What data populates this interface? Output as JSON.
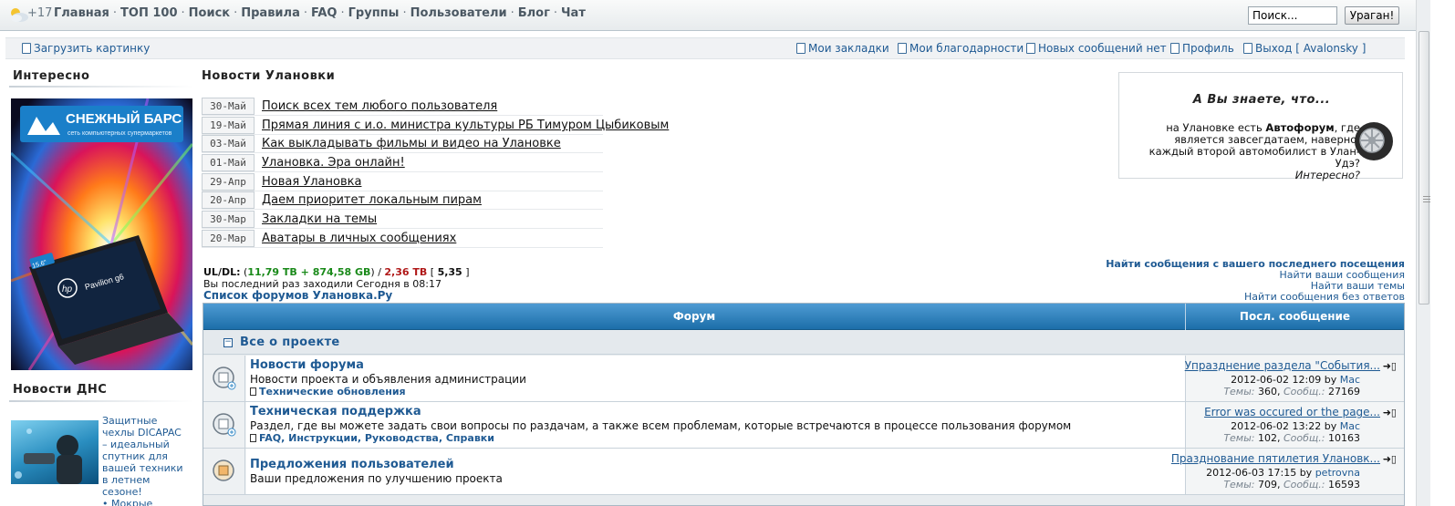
{
  "topbar": {
    "temperature": "+17",
    "nav": [
      "Главная",
      "ТОП 100",
      "Поиск",
      "Правила",
      "FAQ",
      "Группы",
      "Пользователи",
      "Блог",
      "Чат"
    ],
    "separator": "·",
    "search_placeholder": "Поиск...",
    "search_button": "Ураган!"
  },
  "subbar": {
    "upload": "Загрузить картинку",
    "bookmarks": "Мои закладки",
    "thanks": "Мои благодарности",
    "new_posts": "Новых сообщений нет",
    "profile": "Профиль",
    "logout": "Выход [ Avalonsky ]"
  },
  "sidebar": {
    "interesting_title": "Интересно",
    "banner": {
      "brand": "СНЕЖНЫЙ БАРС",
      "tagline": "сеть компьютерных супермаркетов",
      "laptop_model": "Pavilion g6",
      "screen_size": "15.6\""
    },
    "dns_title": "Новости ДНС",
    "dns_text": "Защитные чехлы DICAPAC – идеальный спутник для вашей техники в летнем сезоне!",
    "dns_more": "• Мокрые"
  },
  "news": {
    "title": "Новости Улановки",
    "items": [
      {
        "date": "30-Май",
        "text": "Поиск всех тем любого пользователя"
      },
      {
        "date": "19-Май",
        "text": "Прямая линия с и.о. министра культуры РБ Тимуром Цыбиковым"
      },
      {
        "date": "03-Май",
        "text": "Как выкладывать фильмы и видео на Улановке"
      },
      {
        "date": "01-Май",
        "text": "Улановка. Эра онлайн!"
      },
      {
        "date": "29-Апр",
        "text": "Новая Улановка"
      },
      {
        "date": "20-Апр",
        "text": "Даем приоритет локальным пирам"
      },
      {
        "date": "30-Мар",
        "text": "Закладки на темы"
      },
      {
        "date": "20-Мар",
        "text": "Аватары в личных сообщениях"
      }
    ]
  },
  "did_you_know": {
    "title": "А Вы знаете, что...",
    "prefix": "на Улановке есть ",
    "bold": "Автофорум",
    "suffix": ", где является завсегдатаем, наверно, каждый второй автомобилист в Улан-Удэ?",
    "closing": "Интересно?"
  },
  "stats": {
    "label": "UL/DL:",
    "open": " (",
    "ul": "11,79 TB",
    "plus": " + ",
    "local": "874,58 GB",
    "slash": ") / ",
    "dl": "2,36 TB",
    "ratio_open": " [ ",
    "ratio": "5,35",
    "ratio_close": " ]",
    "last_visit": "Вы последний раз заходили Сегодня в 08:17",
    "forum_list": "Список форумов Улановка.Ру"
  },
  "search_links": [
    "Найти сообщения с вашего последнего посещения",
    "Найти ваши сообщения",
    "Найти ваши темы",
    "Найти сообщения без ответов"
  ],
  "forum_table": {
    "col_forum": "Форум",
    "col_last": "Посл. сообщение",
    "category": "Все о проекте",
    "toggle": "−",
    "by": "by",
    "topics_label": "Темы:",
    "posts_label": "Сообщ.:",
    "rows": [
      {
        "name": "Новости форума",
        "desc": "Новости проекта и объявления администрации",
        "sub": "Технические обновления",
        "last_title": "Упразднение раздела \"События...",
        "last_date": "2012-06-02 12:09",
        "last_user": "Mac",
        "topics": "360",
        "posts": "27169"
      },
      {
        "name": "Техническая поддержка",
        "desc": "Раздел, где вы можете задать свои вопросы по раздачам, а также всем проблемам, которые встречаются в процессе пользования форумом",
        "sub": "FAQ, Инструкции, Руководства, Справки",
        "last_title": "Error was occured or the page...",
        "last_date": "2012-06-02 13:22",
        "last_user": "Mac",
        "topics": "102",
        "posts": "10163"
      },
      {
        "name": "Предложения пользователей",
        "desc": "Ваши предложения по улучшению проекта",
        "sub": "",
        "last_title": "Празднование пятилетия Улановк...",
        "last_date": "2012-06-03 17:15",
        "last_user": "petrovna",
        "topics": "709",
        "posts": "16593"
      }
    ]
  }
}
